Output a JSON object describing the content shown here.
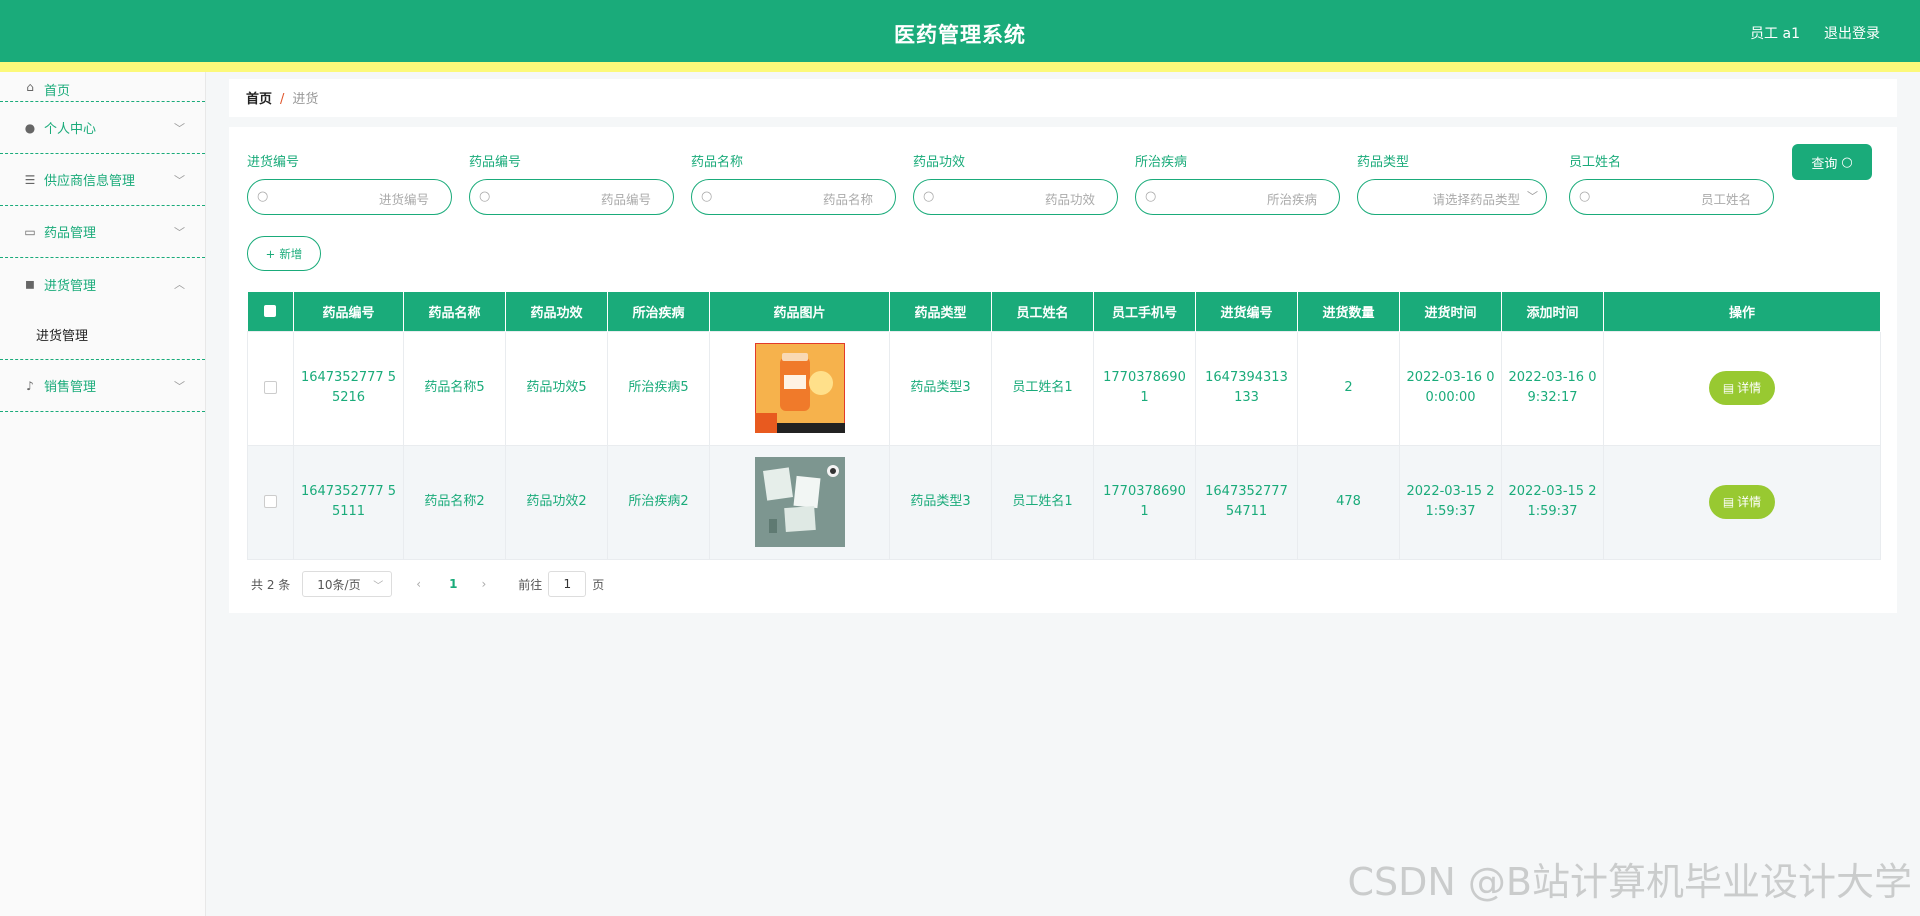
{
  "header": {
    "title": "医药管理系统",
    "user_label": "员工 a1",
    "logout_label": "退出登录",
    "brand_color": "#1aab7a"
  },
  "sidebar": {
    "items": [
      {
        "label": "首页",
        "icon": "home-icon"
      },
      {
        "label": "个人中心",
        "icon": "user-icon"
      },
      {
        "label": "供应商信息管理",
        "icon": "list-icon"
      },
      {
        "label": "药品管理",
        "icon": "card-icon"
      },
      {
        "label": "进货管理",
        "icon": "video-icon",
        "expanded": true,
        "children": [
          {
            "label": "进货管理"
          }
        ]
      },
      {
        "label": "销售管理",
        "icon": "microphone-icon"
      }
    ]
  },
  "breadcrumb": {
    "home": "首页",
    "separator": "/",
    "current": "进货"
  },
  "search": {
    "fields": [
      {
        "label": "进货编号",
        "placeholder": "进货编号"
      },
      {
        "label": "药品编号",
        "placeholder": "药品编号"
      },
      {
        "label": "药品名称",
        "placeholder": "药品名称"
      },
      {
        "label": "药品功效",
        "placeholder": "药品功效"
      },
      {
        "label": "所治疾病",
        "placeholder": "所治疾病"
      },
      {
        "label": "药品类型",
        "placeholder": "请选择药品类型"
      },
      {
        "label": "员工姓名",
        "placeholder": "员工姓名"
      }
    ],
    "query_label": "查询"
  },
  "actions": {
    "add_label": "新增"
  },
  "table": {
    "headers": [
      "药品编号",
      "药品名称",
      "药品功效",
      "所治疾病",
      "药品图片",
      "药品类型",
      "员工姓名",
      "员工手机号",
      "进货编号",
      "进货数量",
      "进货时间",
      "添加时间",
      "操作"
    ],
    "rows": [
      {
        "drug_no": "1647352777 55216",
        "name": "药品名称5",
        "effect": "药品功效5",
        "disease": "所治疾病5",
        "type": "药品类型3",
        "staff": "员工姓名1",
        "phone": "17703786901",
        "purchase_no": "1647394313 133",
        "qty": "2",
        "purchase_time": "2022-03-16 00:00:00",
        "added_time": "2022-03-16 09:32:17",
        "action": "详情"
      },
      {
        "drug_no": "1647352777 55111",
        "name": "药品名称2",
        "effect": "药品功效2",
        "disease": "所治疾病2",
        "type": "药品类型3",
        "staff": "员工姓名1",
        "phone": "17703786901",
        "purchase_no": "1647352777 54711",
        "qty": "478",
        "purchase_time": "2022-03-15 21:59:37",
        "added_time": "2022-03-15 21:59:37",
        "action": "详情"
      }
    ]
  },
  "pager": {
    "total": "共 2 条",
    "page_size": "10条/页",
    "current_page": "1",
    "goto_label": "前往",
    "goto_value": "1",
    "page_suffix": "页"
  },
  "watermark": "CSDN @B站计算机毕业设计大学"
}
